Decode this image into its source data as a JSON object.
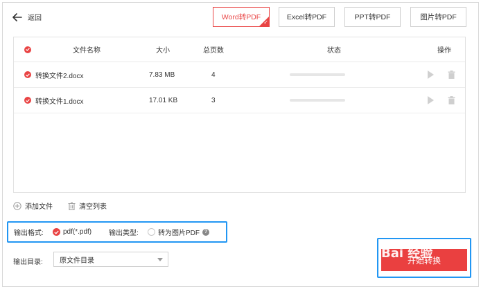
{
  "header": {
    "back_label": "返回",
    "tabs": [
      {
        "label": "Word转PDF",
        "active": true
      },
      {
        "label": "Excel转PDF",
        "active": false
      },
      {
        "label": "PPT转PDF",
        "active": false
      },
      {
        "label": "图片转PDF",
        "active": false
      }
    ]
  },
  "table": {
    "columns": {
      "name": "文件名称",
      "size": "大小",
      "pages": "总页数",
      "status": "状态",
      "actions": "操作"
    },
    "rows": [
      {
        "name": "转换文件2.docx",
        "size": "7.83 MB",
        "pages": "4",
        "progress": 0
      },
      {
        "name": "转换文件1.docx",
        "size": "17.01 KB",
        "pages": "3",
        "progress": 0
      }
    ]
  },
  "actions": {
    "add_file": "添加文件",
    "clear_list": "清空列表"
  },
  "output": {
    "format_label": "输出格式:",
    "format_option": "pdf(*.pdf)",
    "type_label": "输出类型:",
    "type_option": "转为图片PDF",
    "help": "?",
    "dir_label": "输出目录:",
    "dir_value": "原文件目录"
  },
  "convert": {
    "label": "开始转换"
  },
  "watermark": {
    "text": "Bai  经验"
  },
  "colors": {
    "accent": "#e94444",
    "highlight": "#2196f3"
  }
}
